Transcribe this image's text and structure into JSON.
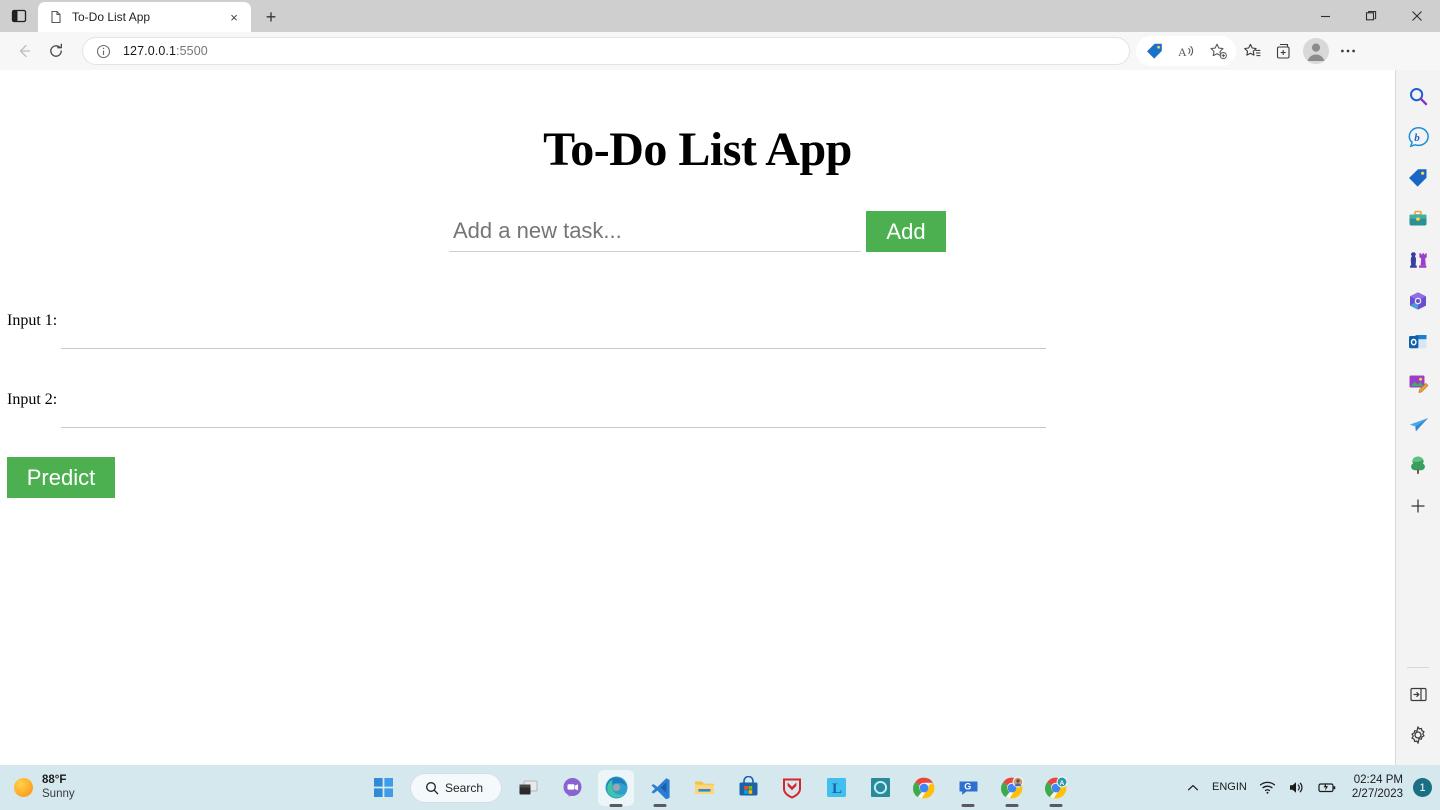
{
  "browser": {
    "tab_actions_icon": "vertical-tabs-icon",
    "tab": {
      "favicon": "document-icon",
      "title": "To-Do List App",
      "close_label": "×"
    },
    "new_tab_label": "+",
    "window_controls": {
      "minimize": "─",
      "maximize": "❐",
      "close": "✕"
    },
    "nav": {
      "back_icon": "arrow-left-icon",
      "refresh_icon": "refresh-icon",
      "info_icon": "site-information-icon",
      "url_host": "127.0.0.1",
      "url_port": ":5500",
      "url_full": "127.0.0.1:5500"
    },
    "toolbar_icons": [
      "shopping-tag-icon",
      "read-aloud-icon",
      "add-favorite-icon",
      "favorites-icon",
      "collections-icon",
      "profile-avatar-icon",
      "settings-and-more-icon"
    ]
  },
  "page": {
    "heading": "To-Do List App",
    "task_input": {
      "placeholder": "Add a new task...",
      "value": ""
    },
    "add_button": "Add",
    "fields": [
      {
        "label": "Input 1:",
        "value": ""
      },
      {
        "label": "Input 2:",
        "value": ""
      }
    ],
    "predict_button": "Predict",
    "accent_green": "#4CAF50"
  },
  "edge_sidebar": {
    "items": [
      {
        "name": "search-icon",
        "title": "Search"
      },
      {
        "name": "bing-chat-icon",
        "title": "Bing Chat"
      },
      {
        "name": "shopping-tag-icon",
        "title": "Shopping"
      },
      {
        "name": "tools-briefcase-icon",
        "title": "Tools"
      },
      {
        "name": "games-chess-icon",
        "title": "Games"
      },
      {
        "name": "microsoft-365-icon",
        "title": "Microsoft 365"
      },
      {
        "name": "outlook-icon",
        "title": "Outlook"
      },
      {
        "name": "image-editor-icon",
        "title": "Image Editor"
      },
      {
        "name": "send-plane-icon",
        "title": "Drop"
      },
      {
        "name": "trees-icon",
        "title": "Trees"
      },
      {
        "name": "add-sidebar-app-icon",
        "title": "Customize"
      }
    ],
    "bottom_items": [
      {
        "name": "expand-sidebar-icon",
        "title": "Expand sidebar"
      },
      {
        "name": "sidebar-settings-gear-icon",
        "title": "Sidebar settings"
      }
    ]
  },
  "taskbar": {
    "weather": {
      "temperature": "88°F",
      "condition": "Sunny",
      "icon": "sun-icon"
    },
    "search": {
      "label": "Search",
      "icon": "search-icon"
    },
    "apps": [
      {
        "name": "start-button",
        "active": false
      },
      {
        "name": "task-view-button",
        "active": false
      },
      {
        "name": "chat-teams-button",
        "active": false
      },
      {
        "name": "edge-button",
        "active": true
      },
      {
        "name": "vs-code-button",
        "active": true
      },
      {
        "name": "file-explorer-button",
        "active": false
      },
      {
        "name": "microsoft-store-button",
        "active": false
      },
      {
        "name": "mcafee-button",
        "active": false
      },
      {
        "name": "l-app-button",
        "active": false
      },
      {
        "name": "teal-app-button",
        "active": false
      },
      {
        "name": "chrome-button",
        "active": false
      },
      {
        "name": "chat-app-button",
        "active": true
      },
      {
        "name": "chrome-profile-button",
        "active": true
      },
      {
        "name": "chrome-profile-a-button",
        "active": true
      }
    ],
    "tray": {
      "show_hidden_icons": "˄",
      "language": {
        "line1": "ENG",
        "line2": "IN"
      },
      "wifi_icon": "wifi-icon",
      "volume_icon": "volume-icon",
      "battery_icon": "battery-charging-icon",
      "time": "02:24 PM",
      "date": "2/27/2023",
      "notification_count": "1"
    }
  }
}
